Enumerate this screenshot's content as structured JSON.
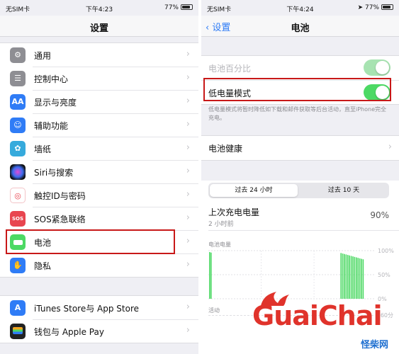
{
  "left": {
    "status": {
      "carrier": "无SIM卡",
      "time": "下午4:23",
      "battery": "77%"
    },
    "title": "设置",
    "group1": [
      {
        "label": "通用",
        "icon": "gear-icon",
        "color": "#8e8e93"
      },
      {
        "label": "控制中心",
        "icon": "sliders-icon",
        "color": "#8e8e93"
      },
      {
        "label": "显示与亮度",
        "icon": "text-size-icon",
        "color": "#2f7cf6"
      },
      {
        "label": "辅助功能",
        "icon": "accessibility-icon",
        "color": "#2f7cf6"
      },
      {
        "label": "墙纸",
        "icon": "flower-icon",
        "color": "#36aadc"
      },
      {
        "label": "Siri与搜索",
        "icon": "siri-icon",
        "color": "#222222"
      },
      {
        "label": "触控ID与密码",
        "icon": "fingerprint-icon",
        "color": "#e8454f"
      },
      {
        "label": "SOS紧急联络",
        "icon": "sos-icon",
        "color": "#e8454f"
      },
      {
        "label": "电池",
        "icon": "battery-icon",
        "color": "#4cd964"
      },
      {
        "label": "隐私",
        "icon": "hand-icon",
        "color": "#2f7cf6"
      }
    ],
    "group2": [
      {
        "label": "iTunes Store与 App Store",
        "icon": "app-store-icon",
        "color": "#2f7cf6"
      },
      {
        "label": "钱包与 Apple Pay",
        "icon": "wallet-icon",
        "color": "#222222"
      }
    ],
    "icon_text": {
      "aa": "AA",
      "sos": "SOS"
    }
  },
  "right": {
    "status": {
      "carrier": "无SIM卡",
      "time": "下午4:24",
      "battery": "77%"
    },
    "back_label": "设置",
    "title": "电池",
    "battery_percentage_label": "电池百分比",
    "low_power_label": "低电量模式",
    "low_power_note": "低电量模式将暂时降低如下载和邮件获取等后台活动，直至iPhone完全充电。",
    "battery_health_label": "电池健康",
    "segments": {
      "active": "过去 24 小时",
      "inactive": "过去 10 天"
    },
    "last_charge": {
      "label": "上次充电电量",
      "sub": "2 小时前",
      "value": "90%"
    }
  },
  "chart_data": {
    "type": "bar",
    "title": "电池电量",
    "ylim": [
      0,
      100
    ],
    "yticks": [
      "100%",
      "50%",
      "0%"
    ],
    "series": [
      {
        "values": [
          97,
          96,
          95,
          94,
          93,
          92,
          91,
          90,
          89,
          88,
          87,
          86,
          85,
          84,
          83,
          82
        ]
      }
    ],
    "group_positions": [
      "start",
      "end"
    ],
    "activity": {
      "label": "活动",
      "ytick": "60分"
    }
  },
  "watermark": {
    "brand": "GuaiChai",
    "cn": "怪柴网"
  },
  "colors": {
    "accent": "#2f7cf6",
    "highlight": "#c81818",
    "toggle_on": "#4cd964"
  }
}
